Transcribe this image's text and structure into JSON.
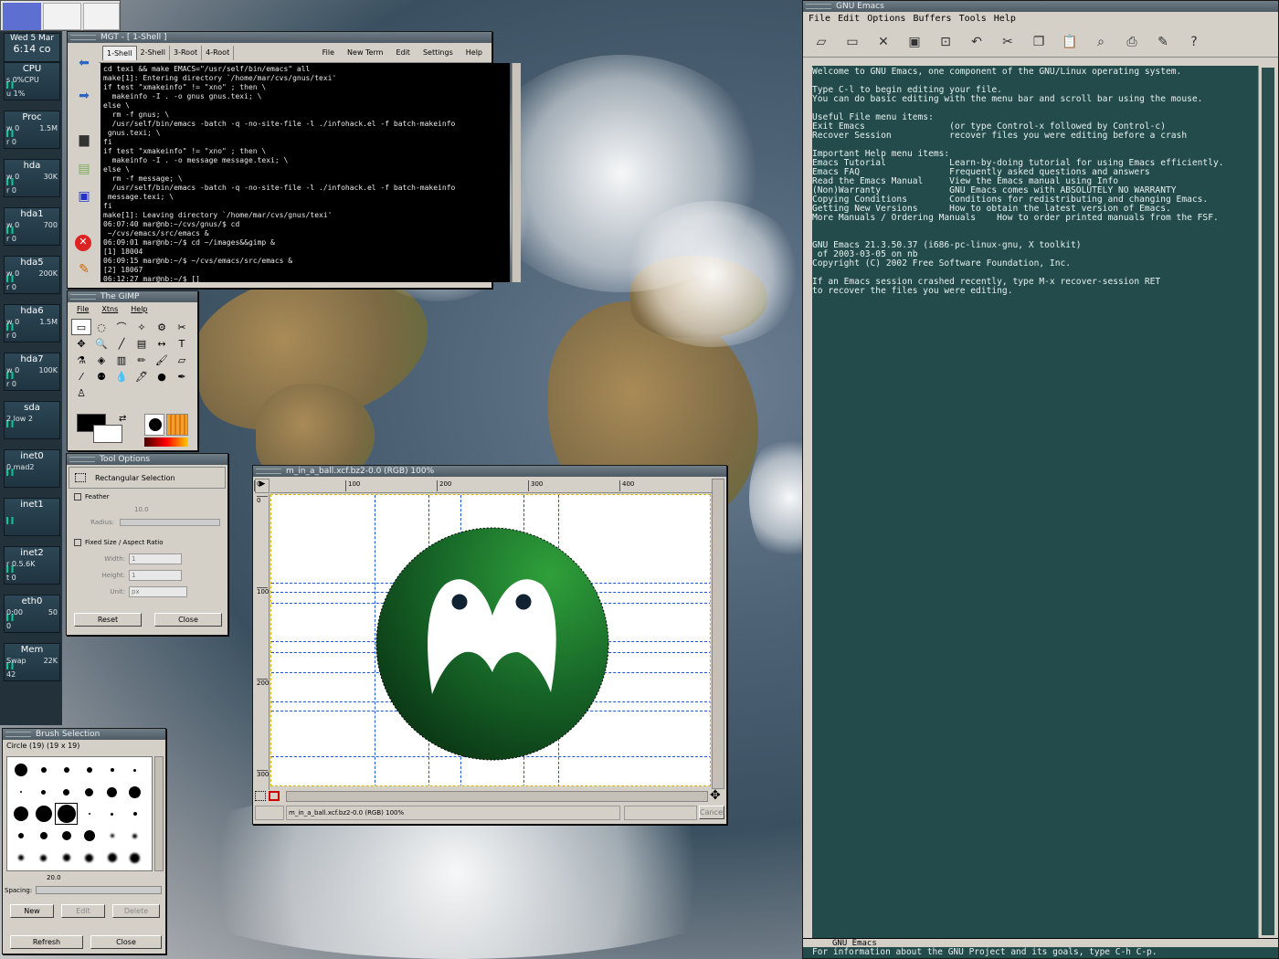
{
  "desktop": {
    "pager_label": "",
    "clock": {
      "date": "Wed  5  Mar",
      "time": "6:14 co"
    }
  },
  "dock": [
    {
      "label": "CPU",
      "l1": "s 0%CPU",
      "l2": "u 1%"
    },
    {
      "label": "Proc",
      "l1": "w 0",
      "r1": "1.5M",
      "l2": "r 0"
    },
    {
      "label": "hda",
      "l1": "w 0",
      "r1": "30K",
      "l2": "r 0"
    },
    {
      "label": "hda1",
      "l1": "w 0",
      "r1": "700",
      "l2": "r 0"
    },
    {
      "label": "hda5",
      "l1": "w 0",
      "r1": "200K",
      "l2": "r 0"
    },
    {
      "label": "hda6",
      "l1": "w 0",
      "r1": "1.5M",
      "l2": "r 0"
    },
    {
      "label": "hda7",
      "l1": "w 0",
      "r1": "100K",
      "l2": "r 0"
    },
    {
      "label": "sda",
      "l1": "2 low 2",
      "r1": "",
      "l2": ""
    },
    {
      "label": "inet0",
      "l1": "0 mad2",
      "r1": "",
      "l2": ""
    },
    {
      "label": "inet1",
      "l1": "",
      "r1": "",
      "l2": ""
    },
    {
      "label": "inet2",
      "l1": "r 0.5.6K",
      "r1": "",
      "l2": "t 0"
    },
    {
      "label": "eth0",
      "l1": "0:00",
      "r1": "50",
      "l2": "0"
    },
    {
      "label": "Mem",
      "l1": "Swap",
      "r1": "22K",
      "l2": "42"
    }
  ],
  "terminal": {
    "title": "MGT - [ 1-Shell ]",
    "tabs": [
      "1-Shell",
      "2-Shell",
      "3-Root",
      "4-Root"
    ],
    "menus": [
      "File",
      "New Term",
      "Edit",
      "Settings",
      "Help"
    ],
    "lines": [
      "cd texi && make EMACS=\"/usr/self/bin/emacs\" all",
      "make[1]: Entering directory `/home/mar/cvs/gnus/texi'",
      "if test \"xmakeinfo\" != \"xno\" ; then \\",
      "  makeinfo -I . -o gnus gnus.texi; \\",
      "else \\",
      "  rm -f gnus; \\",
      "  /usr/self/bin/emacs -batch -q -no-site-file -l ./infohack.el -f batch-makeinfo",
      " gnus.texi; \\",
      "fi",
      "if test \"xmakeinfo\" != \"xno\" ; then \\",
      "  makeinfo -I . -o message message.texi; \\",
      "else \\",
      "  rm -f message; \\",
      "  /usr/self/bin/emacs -batch -q -no-site-file -l ./infohack.el -f batch-makeinfo",
      " message.texi; \\",
      "fi",
      "make[1]: Leaving directory `/home/mar/cvs/gnus/texi'",
      "06:07:40 mar@nb:~/cvs/gnus/$ cd",
      " ~/cvs/emacs/src/emacs &",
      "06:09:01 mar@nb:~/$ cd ~/images&&gimp &",
      "[1] 18004",
      "06:09:15 mar@nb:~/$ ~/cvs/emacs/src/emacs &",
      "[2] 18067",
      "06:12:27 mar@nb:~/$ []"
    ]
  },
  "gimp_toolbox": {
    "title": "The GIMP",
    "menus": [
      "File",
      "Xtns",
      "Help"
    ],
    "tools": [
      "▭",
      "◌",
      "⌒",
      "✧",
      "⚙",
      "✂",
      "✥",
      "🔍",
      "╱",
      "▤",
      "↔",
      "T",
      "⚗",
      "◈",
      "▥",
      "✏",
      "🖌",
      "▱",
      "⁄",
      "⚉",
      "💧",
      "🖊",
      "●",
      "✒",
      "♙"
    ]
  },
  "tool_options": {
    "title": "Tool Options",
    "tool_name": "Rectangular Selection",
    "feather_label": "Feather",
    "radius_label": "Radius:",
    "radius_value": "10.0",
    "fixed_label": "Fixed Size / Aspect Ratio",
    "width_label": "Width:",
    "width_value": "1",
    "height_label": "Height:",
    "height_value": "1",
    "unit_label": "Unit:",
    "unit_value": "px",
    "reset": "Reset",
    "close": "Close"
  },
  "brush": {
    "title": "Brush Selection",
    "current": "Circle (19)   (19 x 19)",
    "spacing_value": "20.0",
    "spacing_label": "Spacing:",
    "buttons": [
      "New",
      "Edit",
      "Delete"
    ],
    "refresh": "Refresh",
    "close": "Close"
  },
  "image_window": {
    "title": "m_in_a_ball.xcf.bz2-0.0 (RGB) 100%",
    "ruler_marks": [
      "0",
      "100",
      "200",
      "300",
      "400"
    ],
    "vruler_marks": [
      "0",
      "100",
      "200",
      "300"
    ],
    "status": "m_in_a_ball.xcf.bz2-0.0 (RGB) 100%",
    "cancel": "Cancel",
    "ball_color": "#1c6b24"
  },
  "emacs": {
    "title": "GNU Emacs",
    "menus": [
      "File",
      "Edit",
      "Options",
      "Buffers",
      "Tools",
      "Help"
    ],
    "toolbar_icons": [
      "new-file-icon",
      "open-folder-icon",
      "close-icon",
      "save-icon",
      "save-as-icon",
      "undo-icon",
      "cut-icon",
      "copy-icon",
      "paste-icon",
      "search-icon",
      "print-icon",
      "customize-icon",
      "help-icon"
    ],
    "buffer": "Welcome to GNU Emacs, one component of the GNU/Linux operating system.\n\nType C-l to begin editing your file.\nYou can do basic editing with the menu bar and scroll bar using the mouse.\n\nUseful File menu items:\nExit Emacs                (or type Control-x followed by Control-c)\nRecover Session           recover files you were editing before a crash\n\nImportant Help menu items:\nEmacs Tutorial            Learn-by-doing tutorial for using Emacs efficiently.\nEmacs FAQ                 Frequently asked questions and answers\nRead the Emacs Manual     View the Emacs manual using Info\n(Non)Warranty             GNU Emacs comes with ABSOLUTELY NO WARRANTY\nCopying Conditions        Conditions for redistributing and changing Emacs.\nGetting New Versions      How to obtain the latest version of Emacs.\nMore Manuals / Ordering Manuals    How to order printed manuals from the FSF.\n\n\nGNU Emacs 21.3.50.37 (i686-pc-linux-gnu, X toolkit)\n of 2003-03-05 on nb\nCopyright (C) 2002 Free Software Foundation, Inc.\n\nIf an Emacs session crashed recently, type M-x recover-session RET\nto recover the files you were editing.",
    "modeline": "GNU Emacs",
    "echo": "For information about the GNU Project and its goals, type C-h C-p.",
    "bg_color": "#234b4b"
  }
}
